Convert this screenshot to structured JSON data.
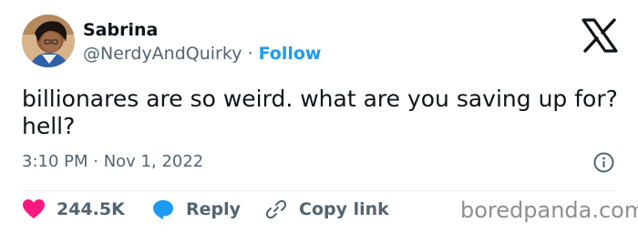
{
  "author": {
    "name": "Sabrina",
    "handle": "@NerdyAndQuirky",
    "separator": "·",
    "follow_label": "Follow"
  },
  "tweet": {
    "text": "billionares are so weird. what are you saving up for? hell?",
    "timestamp": "3:10 PM · Nov 1, 2022"
  },
  "actions": {
    "likes_count": "244.5K",
    "reply_label": "Reply",
    "copy_link_label": "Copy link"
  },
  "watermark": "boredpanda.com",
  "icons": {
    "logo": "x-logo-icon",
    "info": "info-icon",
    "like": "heart-icon",
    "reply": "reply-bubble-icon",
    "copy": "link-icon"
  },
  "colors": {
    "text": "#0f1419",
    "secondary": "#536471",
    "accent": "#1d9bf0",
    "heart": "#f91880",
    "divider": "#eff3f4"
  }
}
